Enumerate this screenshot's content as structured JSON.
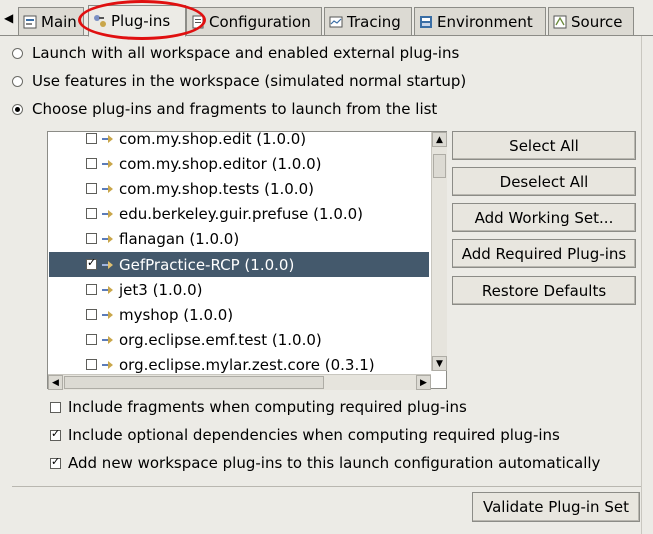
{
  "tabs": [
    {
      "label": "Main",
      "icon": "main-tab-icon"
    },
    {
      "label": "Plug-ins",
      "icon": "plugins-tab-icon",
      "active": true
    },
    {
      "label": "Configuration",
      "icon": "configuration-tab-icon"
    },
    {
      "label": "Tracing",
      "icon": "tracing-tab-icon"
    },
    {
      "label": "Environment",
      "icon": "environment-tab-icon"
    },
    {
      "label": "Source",
      "icon": "source-tab-icon"
    }
  ],
  "launch_options": [
    {
      "label": "Launch with all workspace and enabled external plug-ins",
      "selected": false
    },
    {
      "label": "Use features in the workspace (simulated normal startup)",
      "selected": false
    },
    {
      "label": "Choose plug-ins and fragments to launch from the list",
      "selected": true
    }
  ],
  "plugins": [
    {
      "label": "com.my.shop.edit (1.0.0)",
      "checked": false,
      "selected": false
    },
    {
      "label": "com.my.shop.editor (1.0.0)",
      "checked": false,
      "selected": false
    },
    {
      "label": "com.my.shop.tests (1.0.0)",
      "checked": false,
      "selected": false
    },
    {
      "label": "edu.berkeley.guir.prefuse (1.0.0)",
      "checked": false,
      "selected": false
    },
    {
      "label": "flanagan (1.0.0)",
      "checked": false,
      "selected": false
    },
    {
      "label": "GefPractice-RCP (1.0.0)",
      "checked": true,
      "selected": true
    },
    {
      "label": "jet3 (1.0.0)",
      "checked": false,
      "selected": false
    },
    {
      "label": "myshop (1.0.0)",
      "checked": false,
      "selected": false
    },
    {
      "label": "org.eclipse.emf.test (1.0.0)",
      "checked": false,
      "selected": false
    },
    {
      "label": "org.eclipse.mylar.zest.core (0.3.1)",
      "checked": false,
      "selected": false
    }
  ],
  "buttons": {
    "select_all": "Select All",
    "deselect_all": "Deselect All",
    "add_working_set": "Add Working Set...",
    "add_required": "Add Required Plug-ins",
    "restore_defaults": "Restore Defaults",
    "validate": "Validate Plug-in Set"
  },
  "options": [
    {
      "label": "Include fragments when computing required plug-ins",
      "checked": false
    },
    {
      "label": "Include optional dependencies when computing required plug-ins",
      "checked": true
    },
    {
      "label": "Add new workspace plug-ins to this launch configuration automatically",
      "checked": true
    }
  ],
  "colors": {
    "selection": "#44596c",
    "annotation_circle": "#e01010"
  }
}
